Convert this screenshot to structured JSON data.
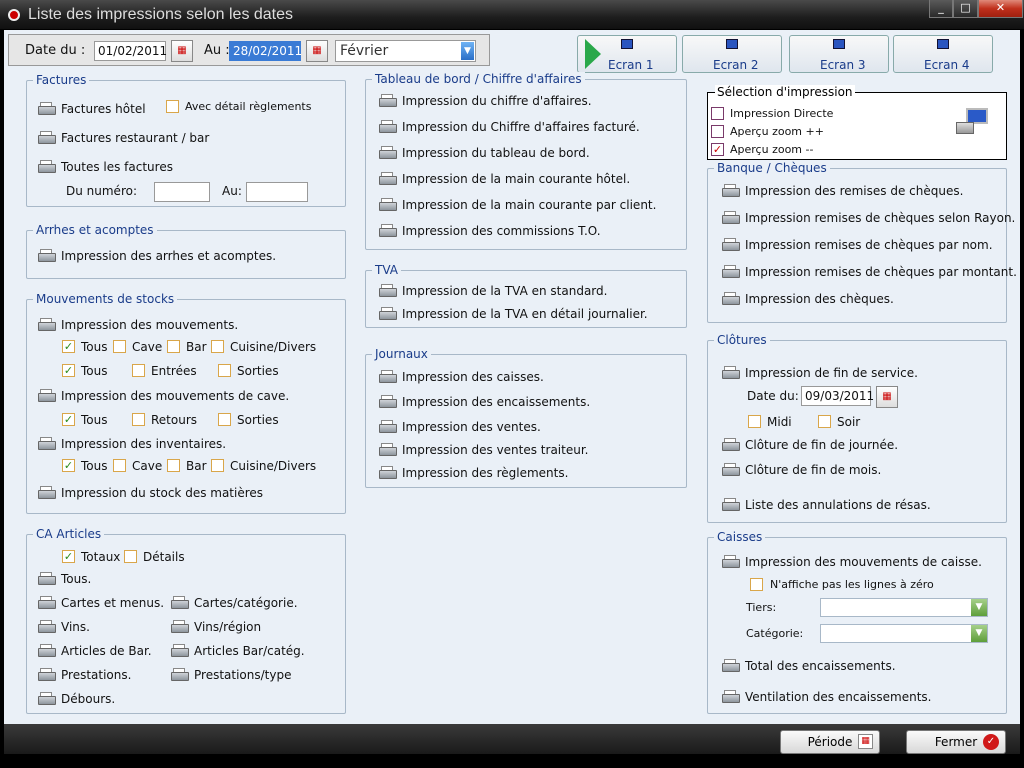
{
  "window": {
    "title": "Liste des impressions selon les dates",
    "min": "_",
    "max": "□",
    "close": "✕"
  },
  "datebar": {
    "from_label": "Date du :",
    "from_value": "01/02/2011",
    "to_label": "Au :",
    "to_value": "28/02/2011",
    "month": "Février"
  },
  "screens": [
    {
      "label": "Ecran 1"
    },
    {
      "label": "Ecran 2"
    },
    {
      "label": "Ecran 3"
    },
    {
      "label": "Ecran 4"
    }
  ],
  "factures": {
    "title": "Factures",
    "hotel": "Factures hôtel",
    "detail": "Avec détail règlements",
    "restaurant": "Factures restaurant / bar",
    "toutes": "Toutes les factures",
    "du_numero": "Du numéro:",
    "au": "Au:"
  },
  "arrhes": {
    "title": "Arrhes et acomptes",
    "item": "Impression des arrhes et acomptes."
  },
  "stocks": {
    "title": "Mouvements de stocks",
    "mouvements": "Impression des mouvements.",
    "tous": "Tous",
    "cave": "Cave",
    "bar": "Bar",
    "cuisine": "Cuisine/Divers",
    "entrees": "Entrées",
    "sorties": "Sorties",
    "mouv_cave": "Impression des mouvements de cave.",
    "retours": "Retours",
    "inventaires": "Impression des inventaires.",
    "stock_matieres": "Impression du stock des matières"
  },
  "ca": {
    "title": "CA Articles",
    "totaux": "Totaux",
    "details": "Détails",
    "tous": "Tous.",
    "cartes_menus": "Cartes et menus.",
    "cartes_cat": "Cartes/catégorie.",
    "vins": "Vins.",
    "vins_region": "Vins/région",
    "articles_bar": "Articles de Bar.",
    "articles_bar_cat": "Articles Bar/catég.",
    "prestations": "Prestations.",
    "prestations_type": "Prestations/type",
    "debours": "Débours."
  },
  "tableau": {
    "title": "Tableau de bord / Chiffre d'affaires",
    "items": [
      "Impression du chiffre d'affaires.",
      "Impression du Chiffre d'affaires facturé.",
      "Impression du tableau de bord.",
      "Impression de la main courante hôtel.",
      "Impression de la main courante par client.",
      "Impression des commissions T.O."
    ]
  },
  "tva": {
    "title": "TVA",
    "items": [
      "Impression de la TVA en standard.",
      "Impression de la TVA en détail journalier."
    ]
  },
  "journaux": {
    "title": "Journaux",
    "items": [
      "Impression des caisses.",
      "Impression des encaissements.",
      "Impression des ventes.",
      "Impression des ventes traiteur.",
      "Impression des règlements."
    ]
  },
  "selection": {
    "title": "Sélection d'impression",
    "directe": "Impression Directe",
    "zoom_plus": "Aperçu zoom ++",
    "zoom_moins": "Aperçu zoom --"
  },
  "banque": {
    "title": "Banque / Chèques",
    "items": [
      "Impression des remises de chèques.",
      "Impression remises de chèques selon Rayon.",
      "Impression remises de chèques par nom.",
      "Impression remises de chèques par montant.",
      "Impression des chèques."
    ]
  },
  "clotures": {
    "title": "Clôtures",
    "fin_service": "Impression de fin de service.",
    "date_label": "Date du:",
    "date_value": "09/03/2011",
    "midi": "Midi",
    "soir": "Soir",
    "fin_journee": "Clôture de fin de journée.",
    "fin_mois": "Clôture de fin de mois.",
    "annulations": "Liste des annulations de résas."
  },
  "caisses": {
    "title": "Caisses",
    "mouvements": "Impression des mouvements de caisse.",
    "naffiche": "N'affiche pas les lignes à zéro",
    "tiers": "Tiers:",
    "categorie": "Catégorie:",
    "total": "Total des encaissements.",
    "ventilation": "Ventilation des encaissements."
  },
  "buttons": {
    "periode": "Période",
    "fermer": "Fermer"
  }
}
